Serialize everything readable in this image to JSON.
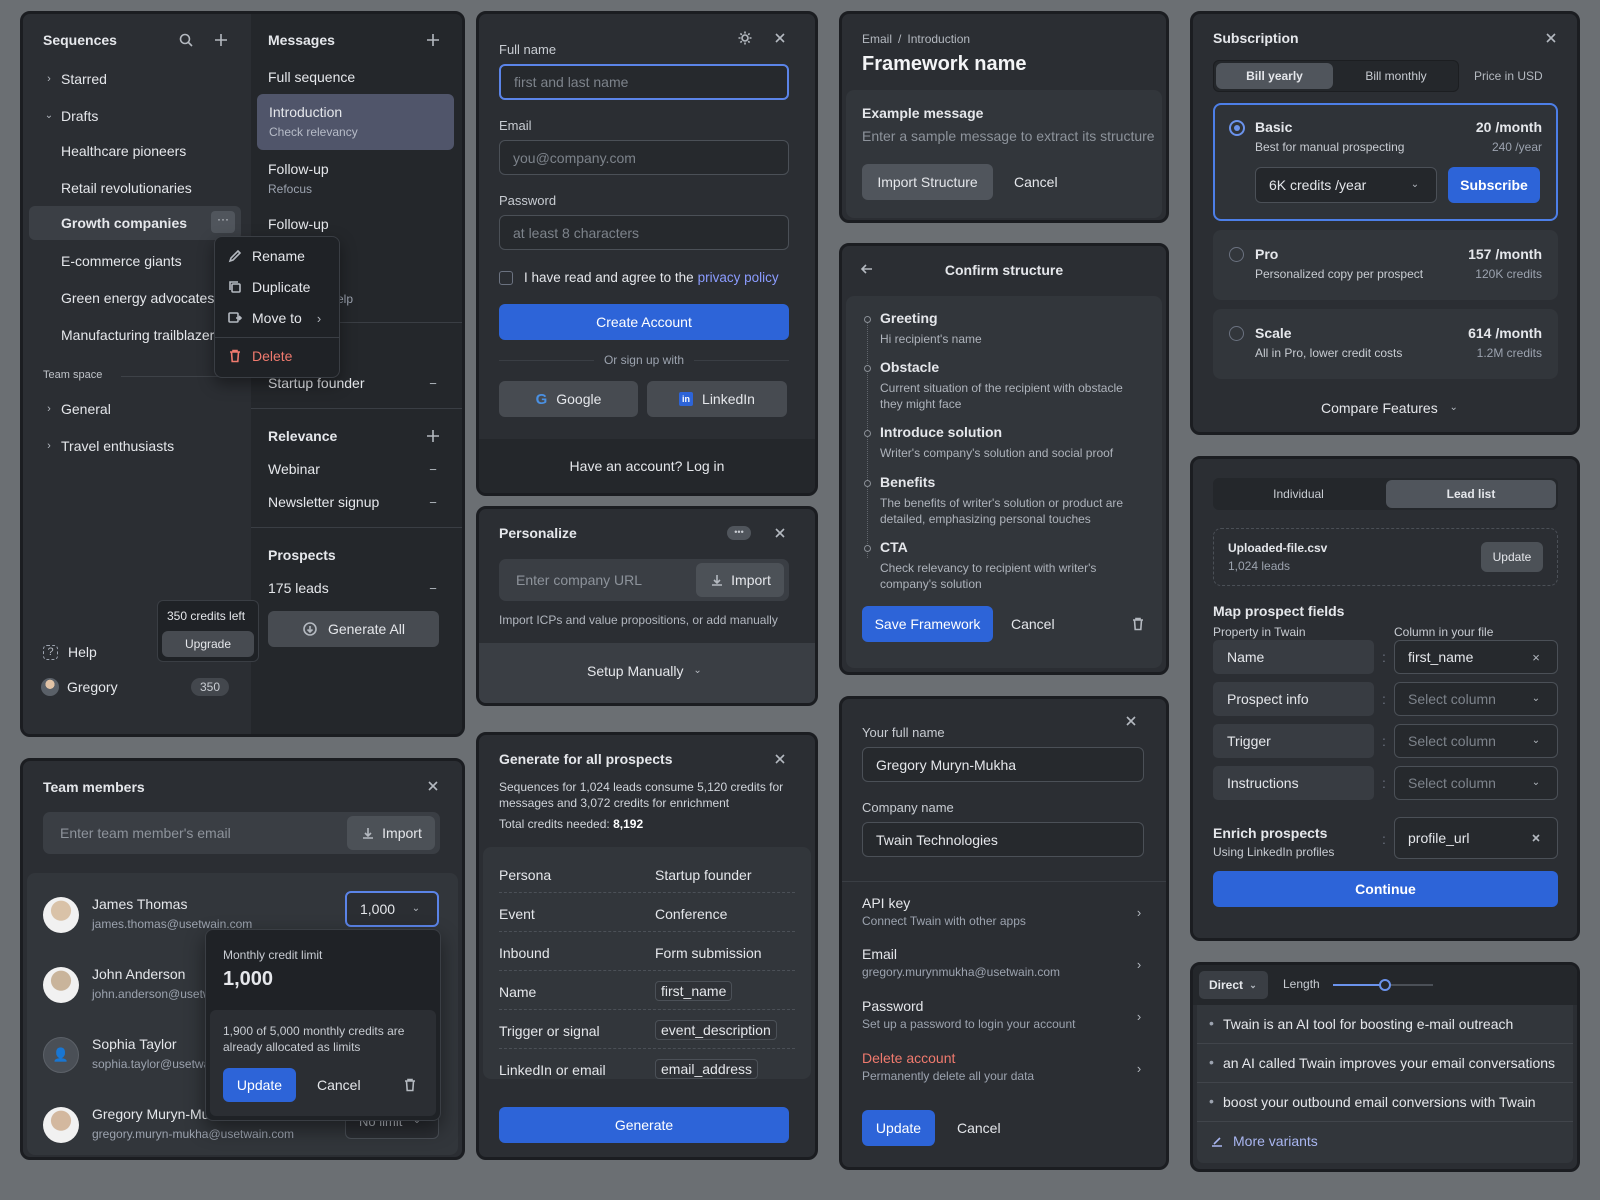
{
  "sequences": {
    "title": "Sequences",
    "items": [
      "Starred",
      "Drafts",
      "Healthcare pioneers",
      "Retail revolutionaries",
      "Growth companies",
      "E-commerce giants",
      "Green energy advocates",
      "Manufacturing trailblazers"
    ],
    "team_space": "Team space",
    "team_items": [
      "General",
      "Travel enthusiasts"
    ],
    "context_menu": [
      "Rename",
      "Duplicate",
      "Move to",
      "Delete"
    ],
    "credits_left": "350 credits left",
    "upgrade": "Upgrade",
    "help": "Help",
    "user": "Gregory",
    "user_credits": "350"
  },
  "messages": {
    "title": "Messages",
    "full_sequence": "Full sequence",
    "items": [
      {
        "title": "Introduction",
        "sub": "Check relevancy"
      },
      {
        "title": "Follow-up",
        "sub": "Refocus"
      },
      {
        "title": "Follow-up",
        "sub": ""
      }
    ],
    "partial_help": "elp",
    "startup_founder": "Startup founder",
    "relevance": "Relevance",
    "relevance_items": [
      "Webinar",
      "Newsletter signup"
    ],
    "prospects": "Prospects",
    "leads": "175 leads",
    "generate_all": "Generate All"
  },
  "signup": {
    "full_name_label": "Full name",
    "full_name_ph": "first and last name",
    "email_label": "Email",
    "email_ph": "you@company.com",
    "password_label": "Password",
    "password_ph": "at least 8 characters",
    "agree_text": "I have read and agree to the",
    "privacy": "privacy policy",
    "create": "Create Account",
    "or": "Or sign up with",
    "google": "Google",
    "linkedin": "LinkedIn",
    "have_account": "Have an account? Log in"
  },
  "personalize": {
    "title": "Personalize",
    "url_ph": "Enter company URL",
    "import": "Import",
    "hint": "Import ICPs and value propositions, or add manually",
    "setup": "Setup Manually"
  },
  "generate": {
    "title": "Generate for all prospects",
    "desc": "Sequences for 1,024 leads consume 5,120 credits for messages and 3,072 credits for enrichment",
    "total_label": "Total credits needed:",
    "total_value": "8,192",
    "rows": [
      {
        "k": "Persona",
        "v": "Startup founder"
      },
      {
        "k": "Event",
        "v": "Conference"
      },
      {
        "k": "Inbound",
        "v": "Form submission"
      },
      {
        "k": "Name",
        "v": "first_name"
      },
      {
        "k": "Trigger or signal",
        "v": "event_description"
      },
      {
        "k": "LinkedIn or email",
        "v": "email_address"
      }
    ],
    "button": "Generate"
  },
  "framework": {
    "crumb1": "Email",
    "crumb2": "Introduction",
    "title": "Framework name",
    "example_title": "Example message",
    "example_ph": "Enter a sample message to extract its structure",
    "import": "Import Structure",
    "cancel": "Cancel"
  },
  "confirm": {
    "title": "Confirm structure",
    "steps": [
      {
        "t": "Greeting",
        "d": "Hi recipient's name"
      },
      {
        "t": "Obstacle",
        "d": "Current situation of the recipient with obstacle they might face"
      },
      {
        "t": "Introduce solution",
        "d": "Writer's company's solution and social proof"
      },
      {
        "t": "Benefits",
        "d": "The benefits of writer's solution or product are detailed, emphasizing personal touches"
      },
      {
        "t": "CTA",
        "d": "Check relevancy to recipient with writer's company's solution"
      }
    ],
    "save": "Save Framework",
    "cancel": "Cancel"
  },
  "profile": {
    "name_label": "Your full name",
    "name_value": "Gregory Muryn-Mukha",
    "company_label": "Company name",
    "company_value": "Twain Technologies",
    "links": [
      {
        "t": "API key",
        "d": "Connect Twain with other apps",
        "danger": false
      },
      {
        "t": "Email",
        "d": "gregory.murynmukha@usetwain.com",
        "danger": false
      },
      {
        "t": "Password",
        "d": "Set up a password to login your account",
        "danger": false
      },
      {
        "t": "Delete account",
        "d": "Permanently delete all your data",
        "danger": true
      }
    ],
    "update": "Update",
    "cancel": "Cancel"
  },
  "subscription": {
    "title": "Subscription",
    "bill_yearly": "Bill yearly",
    "bill_monthly": "Bill monthly",
    "currency": "Price in USD",
    "plans": [
      {
        "name": "Basic",
        "desc": "Best for manual prospecting",
        "price": "20 /month",
        "sub": "240 /year"
      },
      {
        "name": "Pro",
        "desc": "Personalized copy per prospect",
        "price": "157 /month",
        "sub": "120K credits"
      },
      {
        "name": "Scale",
        "desc": "All in Pro, lower credit costs",
        "price": "614 /month",
        "sub": "1.2M credits"
      }
    ],
    "credits_select": "6K credits /year",
    "subscribe": "Subscribe",
    "compare": "Compare Features"
  },
  "leadlist": {
    "tab_individual": "Individual",
    "tab_lead": "Lead list",
    "file": "Uploaded-file.csv",
    "file_leads": "1,024 leads",
    "update": "Update",
    "map_title": "Map prospect fields",
    "col_property": "Property in Twain",
    "col_file": "Column in your file",
    "fields": [
      {
        "k": "Name",
        "v": "first_name",
        "set": true
      },
      {
        "k": "Prospect info",
        "v": "Select column",
        "set": false
      },
      {
        "k": "Trigger",
        "v": "Select column",
        "set": false
      },
      {
        "k": "Instructions",
        "v": "Select column",
        "set": false
      }
    ],
    "enrich_title": "Enrich prospects",
    "enrich_sub": "Using LinkedIn profiles",
    "enrich_value": "profile_url",
    "continue": "Continue"
  },
  "variants": {
    "mode": "Direct",
    "length_label": "Length",
    "length_level": 0.52,
    "items": [
      "Twain is an AI tool for boosting e-mail outreach",
      "an AI called Twain improves your email conversations",
      "boost your outbound email conversions with Twain"
    ],
    "more": "More variants"
  },
  "team": {
    "title": "Team members",
    "email_ph": "Enter team member's email",
    "import": "Import",
    "members": [
      {
        "name": "James Thomas",
        "email": "james.thomas@usetwain.com",
        "limit": "1,000"
      },
      {
        "name": "John Anderson",
        "email": "john.anderson@usetw"
      },
      {
        "name": "Sophia Taylor",
        "email": "sophia.taylor@usetwa"
      },
      {
        "name": "Gregory Muryn-Mu",
        "email": "gregory.muryn-mukha@usetwain.com",
        "limit": "No limit"
      }
    ],
    "popover_label": "Monthly credit limit",
    "popover_value": "1,000",
    "popover_note": "1,900 of 5,000 monthly credits are already allocated as limits",
    "update": "Update",
    "cancel": "Cancel"
  },
  "colors": {
    "accent": "#2d64d8",
    "panel": "#2b2e33",
    "danger": "#f07a6e",
    "link": "#8b9cff"
  }
}
